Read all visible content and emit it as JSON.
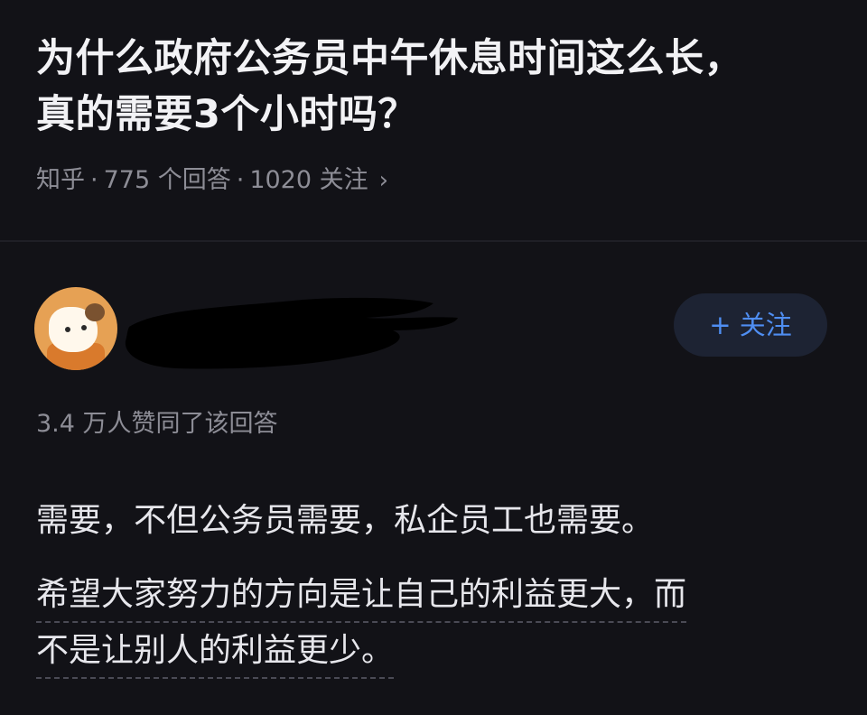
{
  "question": {
    "title_line1": "为什么政府公务员中午休息时间这么长，",
    "title_line2": "真的需要3个小时吗？"
  },
  "meta": {
    "source": "知乎",
    "separator": "·",
    "answers": "775 个回答",
    "followers": "1020 关注",
    "chevron": "›"
  },
  "author": {
    "avatar_icon": "cartoon-dog-avatar",
    "name_redacted": true
  },
  "follow_button": {
    "label": "+ 关注",
    "color": "#4f8ef2"
  },
  "answer": {
    "agree_text": "3.4 万人赞同了该回答",
    "paragraph1": "需要，不但公务员需要，私企员工也需要。",
    "paragraph2_line1": "希望大家努力的方向是让自己的利益更大，而",
    "paragraph2_line2": "不是让别人的利益更少。"
  },
  "colors": {
    "background": "#121217",
    "title": "#f2f2f5",
    "muted": "#8d8d96",
    "accent": "#4f8ef2"
  }
}
